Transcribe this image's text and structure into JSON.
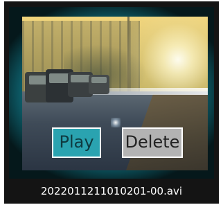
{
  "preview": {
    "buttons": {
      "play_label": "Play",
      "delete_label": "Delete"
    }
  },
  "file": {
    "name": "2022011211010201-00.avi"
  },
  "colors": {
    "frame_accent": "#1aa6b6",
    "play_button": "#2aa3b0",
    "delete_button": "#b3b3b3",
    "background": "#141414"
  }
}
